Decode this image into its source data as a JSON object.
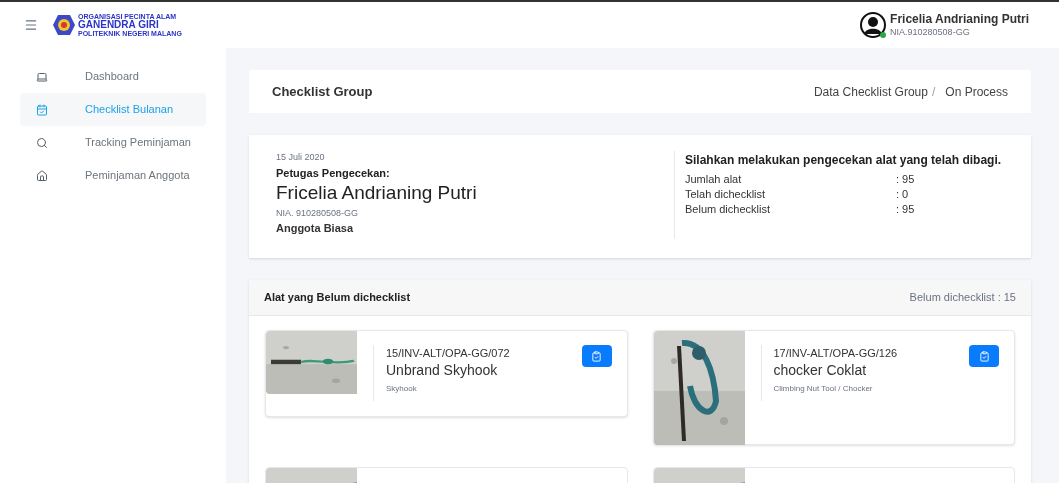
{
  "logo": {
    "top": "ORGANISASI PECINTA ALAM",
    "name": "GANENDRA GIRI",
    "bottom": "POLITEKNIK NEGERI MALANG"
  },
  "user": {
    "name": "Fricelia Andrianing Putri",
    "nia": "NIA.910280508-GG",
    "online": true
  },
  "sidebar": {
    "items": [
      {
        "label": "Dashboard",
        "selected": false
      },
      {
        "label": "Checklist Bulanan",
        "selected": true
      },
      {
        "label": "Tracking Peminjaman",
        "selected": false
      },
      {
        "label": "Peminjaman Anggota",
        "selected": false
      }
    ]
  },
  "page_header": {
    "title": "Checklist Group",
    "breadcrumb": [
      "Data Checklist Group",
      "On Process"
    ],
    "separator": "/"
  },
  "info": {
    "date": "15 Juli 2020",
    "officer_label": "Petugas Pengecekan:",
    "officer_name": "Fricelia Andrianing Putri",
    "nia": "NIA. 910280508-GG",
    "role": "Anggota Biasa",
    "instruction": "Silahkan melakukan pengecekan alat yang telah dibagi.",
    "stats": [
      {
        "label": "Jumlah alat",
        "value": ": 95"
      },
      {
        "label": "Telah dichecklist",
        "value": ": 0"
      },
      {
        "label": "Belum dichecklist",
        "value": ": 95"
      }
    ]
  },
  "unchecked": {
    "title": "Alat yang Belum dichecklist",
    "count": "Belum dichecklist : 15",
    "items": [
      {
        "code": "15/INV-ALT/OPA-GG/072",
        "name": "Unbrand Skyhook",
        "category": "Skyhook",
        "kind": "full"
      },
      {
        "code": "17/INV-ALT/OPA-GG/126",
        "name": "chocker Coklat",
        "category": "Climbing Nut Tool / Chocker",
        "kind": "full"
      },
      {
        "kind": "picture"
      },
      {
        "kind": "picture"
      }
    ]
  }
}
